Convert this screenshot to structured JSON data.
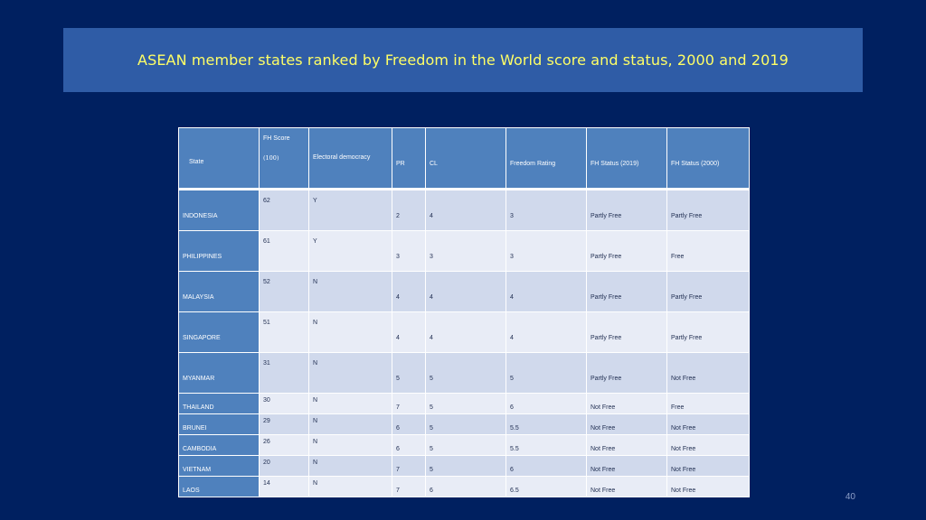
{
  "title": "ASEAN member states ranked by Freedom in the World score and status, 2000 and 2019",
  "columns": {
    "state": "State",
    "fh_score": "FH Score",
    "fh_score_sub": "(100)",
    "electoral_democracy": "Electoral democracy",
    "pr": "PR",
    "cl": "CL",
    "freedom_rating": "Freedom Rating",
    "fh_status_2019": "FH Status (2019)",
    "fh_status_2000": "FH Status (2000)"
  },
  "rows": [
    {
      "state": "INDONESIA",
      "score": "62",
      "ed": "Y",
      "pr": "2",
      "cl": "4",
      "fr": "3",
      "s2019": "Partly Free",
      "s2000": "Partly Free"
    },
    {
      "state": "PHILIPPINES",
      "score": "61",
      "ed": "Y",
      "pr": "3",
      "cl": "3",
      "fr": "3",
      "s2019": "Partly Free",
      "s2000": "Free"
    },
    {
      "state": "MALAYSIA",
      "score": "52",
      "ed": "N",
      "pr": "4",
      "cl": "4",
      "fr": "4",
      "s2019": "Partly Free",
      "s2000": "Partly Free"
    },
    {
      "state": "SINGAPORE",
      "score": "51",
      "ed": "N",
      "pr": "4",
      "cl": "4",
      "fr": "4",
      "s2019": "Partly Free",
      "s2000": "Partly Free"
    },
    {
      "state": "MYANMAR",
      "score": "31",
      "ed": "N",
      "pr": "5",
      "cl": "5",
      "fr": "5",
      "s2019": "Partly Free",
      "s2000": "Not Free"
    },
    {
      "state": "THAILAND",
      "score": "30",
      "ed": "N",
      "pr": "7",
      "cl": "5",
      "fr": "6",
      "s2019": "Not Free",
      "s2000": "Free"
    },
    {
      "state": "BRUNEI",
      "score": "29",
      "ed": "N",
      "pr": "6",
      "cl": "5",
      "fr": "5.5",
      "s2019": "Not Free",
      "s2000": "Not Free"
    },
    {
      "state": "CAMBODIA",
      "score": "26",
      "ed": "N",
      "pr": "6",
      "cl": "5",
      "fr": "5.5",
      "s2019": "Not Free",
      "s2000": "Not Free"
    },
    {
      "state": "VIETNAM",
      "score": "20",
      "ed": "N",
      "pr": "7",
      "cl": "5",
      "fr": "6",
      "s2019": "Not Free",
      "s2000": "Not Free"
    },
    {
      "state": "LAOS",
      "score": "14",
      "ed": "N",
      "pr": "7",
      "cl": "6",
      "fr": "6.5",
      "s2019": "Not Free",
      "s2000": "Not Free"
    }
  ],
  "page_number": "40"
}
